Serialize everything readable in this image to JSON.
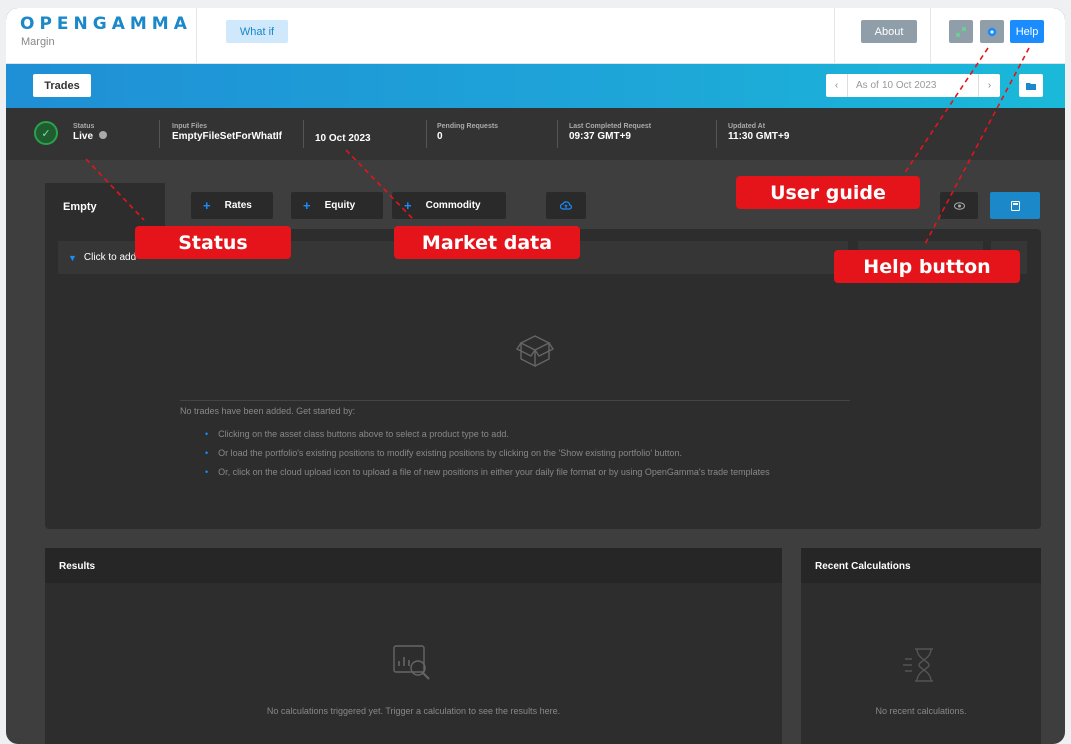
{
  "header": {
    "logo": "OPENGAMMA",
    "subtitle": "Margin",
    "whatif_label": "What if",
    "about_label": "About",
    "help_label": "Help"
  },
  "toolbar": {
    "trades_label": "Trades",
    "asof_prefix": "As of",
    "asof_date": "10 Oct 2023"
  },
  "status": {
    "status_label": "Status",
    "status_value": "Live",
    "input_files_label": "Input Files",
    "input_files_value": "EmptyFileSetForWhatIf",
    "input_date": "10 Oct 2023",
    "pending_label": "Pending Requests",
    "pending_value": "0",
    "last_completed_label": "Last Completed Request",
    "last_completed_value": "09:37 GMT+9",
    "updated_label": "Updated At",
    "updated_value": "11:30 GMT+9"
  },
  "portfolio": {
    "tab_label": "Empty",
    "asset_buttons": [
      "Rates",
      "Equity",
      "Commodity"
    ],
    "filter_placeholder": "Click to add",
    "empty_lead": "No trades have been added. Get started by:",
    "empty_steps": [
      "Clicking on the asset class buttons above to select a product type to add.",
      "Or load the portfolio's existing positions to modify existing positions by clicking on the 'Show existing portfolio' button.",
      "Or, click on the cloud upload icon to upload a file of new positions in either your daily file format or by using OpenGamma's trade templates"
    ]
  },
  "results": {
    "title": "Results",
    "empty_text": "No calculations triggered yet. Trigger a calculation to see the results here."
  },
  "recent": {
    "title": "Recent Calculations",
    "empty_text": "No recent calculations."
  },
  "annotations": {
    "user_guide": "User guide",
    "status": "Status",
    "market_data": "Market data",
    "help_button": "Help button"
  },
  "colors": {
    "accent": "#1a8cff",
    "callout": "#e5141a",
    "live": "#2aa24b"
  }
}
